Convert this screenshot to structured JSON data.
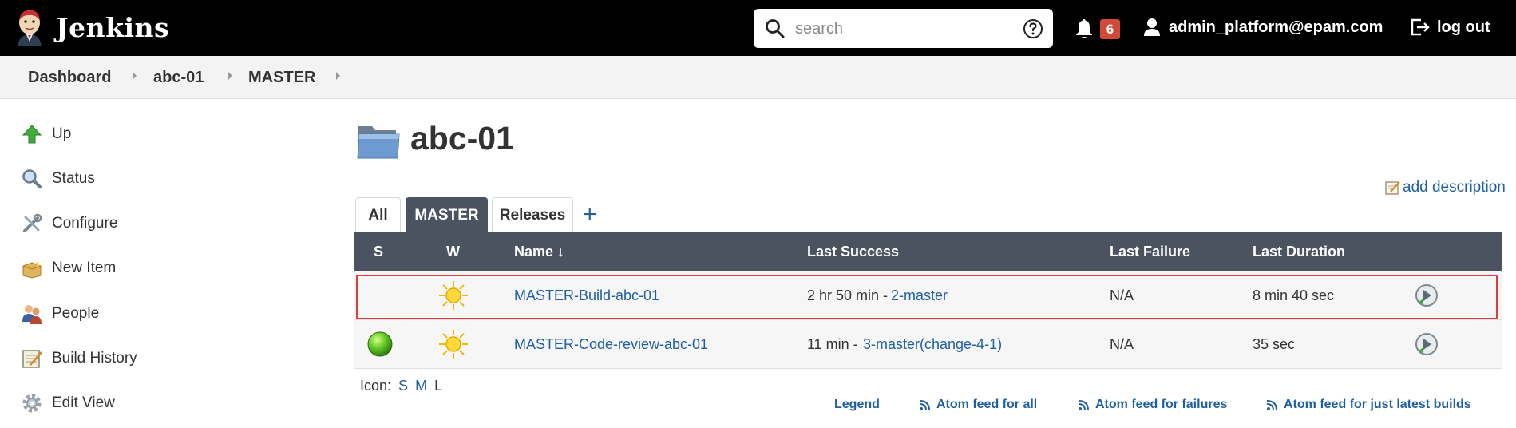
{
  "header": {
    "app_name": "Jenkins",
    "search_placeholder": "search",
    "notification_count": "6",
    "user": "admin_platform@epam.com",
    "logout": "log out"
  },
  "breadcrumb": [
    "Dashboard",
    "abc-01",
    "MASTER"
  ],
  "sidebar": {
    "items": [
      {
        "label": "Up",
        "icon": "up-arrow-icon"
      },
      {
        "label": "Status",
        "icon": "magnifier-icon"
      },
      {
        "label": "Configure",
        "icon": "wrench-screwdriver-icon"
      },
      {
        "label": "New Item",
        "icon": "new-package-icon"
      },
      {
        "label": "People",
        "icon": "people-icon"
      },
      {
        "label": "Build History",
        "icon": "notepad-icon"
      },
      {
        "label": "Edit View",
        "icon": "gear-icon"
      }
    ]
  },
  "main": {
    "title": "abc-01",
    "add_description": "add description",
    "tabs": [
      "All",
      "MASTER",
      "Releases"
    ],
    "active_tab": "MASTER",
    "add_tab": "+",
    "table": {
      "headers": {
        "s": "S",
        "w": "W",
        "name": "Name ↓",
        "last_success": "Last Success",
        "last_failure": "Last Failure",
        "last_duration": "Last Duration"
      },
      "rows": [
        {
          "status": "none",
          "weather": "sunny",
          "name": "MASTER-Build-abc-01",
          "last_success_time": "2 hr 50 min - ",
          "last_success_build": "2-master",
          "last_failure": "N/A",
          "last_duration": "8 min 40 sec",
          "highlighted": true
        },
        {
          "status": "success",
          "weather": "sunny",
          "name": "MASTER-Code-review-abc-01",
          "last_success_time": "11 min - ",
          "last_success_build": "3-master(change-4-1)",
          "last_failure": "N/A",
          "last_duration": "35 sec",
          "highlighted": false
        }
      ]
    },
    "icon_label": "Icon:",
    "icon_sizes": [
      "S",
      "M",
      "L"
    ],
    "current_icon_size": "L",
    "footer_links": [
      "Legend",
      "Atom feed for all",
      "Atom feed for failures",
      "Atom feed for just latest builds"
    ]
  },
  "colors": {
    "header_bg": "#000000",
    "badge": "#d24939",
    "table_header": "#4b5361",
    "link": "#1f5fa3",
    "highlight_border": "#e03c3c",
    "status_ball": "#2ea82a"
  }
}
